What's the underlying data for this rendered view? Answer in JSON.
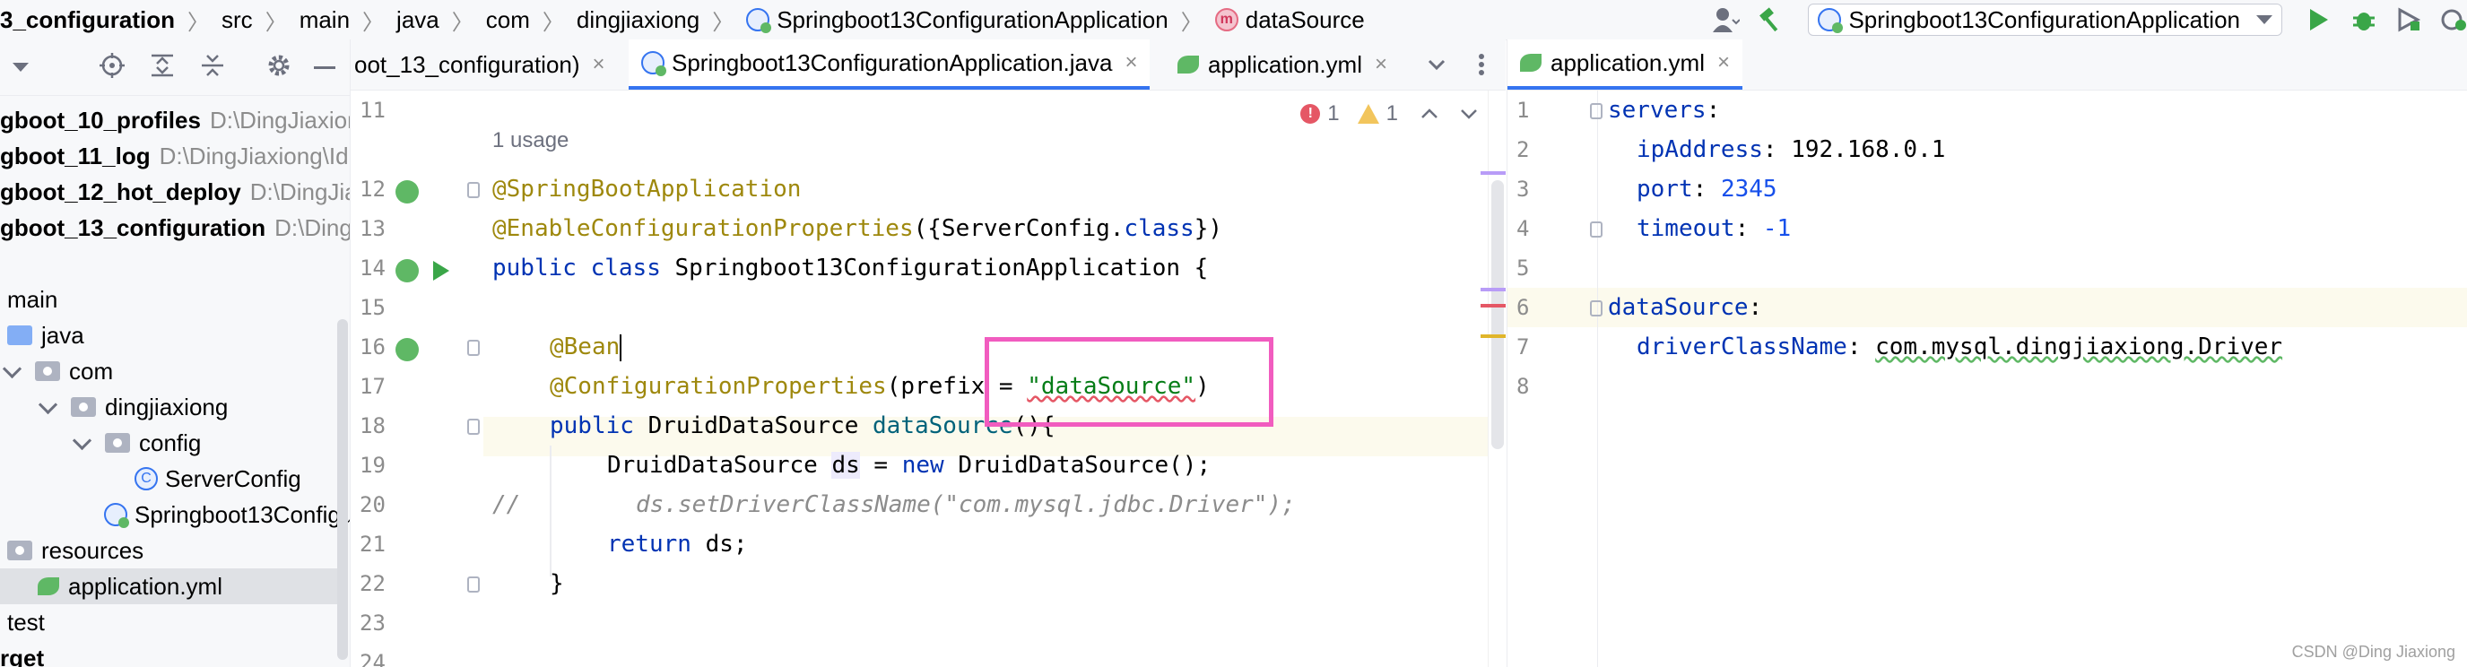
{
  "breadcrumb": {
    "items": [
      "3_configuration",
      "src",
      "main",
      "java",
      "com",
      "dingjiaxiong",
      "Springboot13ConfigurationApplication",
      "dataSource"
    ]
  },
  "toolbar": {
    "run_config": "Springboot13ConfigurationApplication"
  },
  "project_tree": {
    "items": [
      {
        "label": "gboot_10_profiles",
        "path": "D:\\DingJiaxion"
      },
      {
        "label": "gboot_11_log",
        "path": "D:\\DingJiaxiong\\Id"
      },
      {
        "label": "gboot_12_hot_deploy",
        "path": "D:\\DingJia"
      },
      {
        "label": "gboot_13_configuration",
        "path": "D:\\Ding"
      },
      {
        "label": "main",
        "path": ""
      },
      {
        "label": "java",
        "path": ""
      },
      {
        "label": "com",
        "path": ""
      },
      {
        "label": "dingjiaxiong",
        "path": ""
      },
      {
        "label": "config",
        "path": ""
      },
      {
        "label": "ServerConfig",
        "path": ""
      },
      {
        "label": "Springboot13Configu",
        "path": ""
      },
      {
        "label": "resources",
        "path": ""
      },
      {
        "label": "application.yml",
        "path": ""
      },
      {
        "label": "test",
        "path": ""
      },
      {
        "label": "rget",
        "path": ""
      }
    ]
  },
  "editor_tabs": {
    "tab1": "oot_13_configuration)",
    "tab2": "Springboot13ConfigurationApplication.java",
    "tab3": "application.yml",
    "close": "×"
  },
  "editor_right_tabs": {
    "tab1": "application.yml",
    "close": "×"
  },
  "inspection": {
    "errors": "1",
    "warnings": "1",
    "error_icon": "!"
  },
  "java_editor": {
    "line_numbers": [
      "11",
      "12",
      "13",
      "14",
      "15",
      "16",
      "17",
      "18",
      "19",
      "20",
      "21",
      "22",
      "23",
      "24"
    ],
    "usage_hint": "1 usage",
    "l12": "@SpringBootApplication",
    "l13_ann": "@EnableConfigurationProperties",
    "l13_a": "({ServerConfig.",
    "l13_kw": "class",
    "l13_b": "})",
    "l14_kw1": "public",
    "l14_kw2": "class",
    "l14_rest": " Springboot13ConfigurationApplication {",
    "l16_ann": "@Bean",
    "l17_ann": "@ConfigurationProperties",
    "l17_a": "(prefix = ",
    "l17_str": "\"dataSource\"",
    "l17_b": ")",
    "l18_kw": "public",
    "l18_type": " DruidDataSource ",
    "l18_fn": "dataSource",
    "l18_b": "(){",
    "l19_type": "DruidDataSource ",
    "l19_var": "ds",
    "l19_eq": " = ",
    "l19_kw": "new",
    "l19_rest": " DruidDataSource();",
    "l20_slash": "//",
    "l20_cmt": "ds.setDriverClassName(\"com.mysql.jdbc.Driver\");",
    "l21_kw": "return",
    "l21_rest": " ds;",
    "l22": "}"
  },
  "yml_editor": {
    "line_numbers": [
      "1",
      "2",
      "3",
      "4",
      "5",
      "6",
      "7",
      "8"
    ],
    "l1_key": "servers",
    "l2_key": "ipAddress",
    "l2_val": "192.168.0.1",
    "l3_key": "port",
    "l3_val": "2345",
    "l4_key": "timeout",
    "l4_val": "-1",
    "l6_key": "dataSource",
    "l7_key": "driverClassName",
    "l7_val": "com.mysql.dingjiaxiong.Driver",
    "colon": ":"
  },
  "watermark": "CSDN @Ding Jiaxiong"
}
